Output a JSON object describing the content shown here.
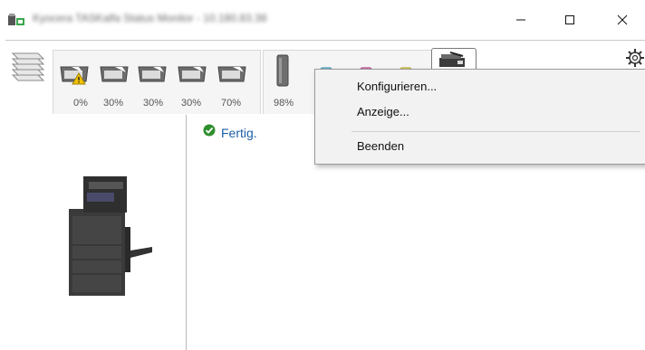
{
  "window": {
    "title": "Kyocera TASKalfa Status Monitor - 10.180.83.38",
    "buttons": {
      "minimize": "—",
      "maximize": "☐",
      "close": "✕"
    }
  },
  "toolbar": {
    "trays": [
      {
        "label": "0%",
        "warning": true
      },
      {
        "label": "30%",
        "warning": false
      },
      {
        "label": "30%",
        "warning": false
      },
      {
        "label": "30%",
        "warning": false
      },
      {
        "label": "70%",
        "warning": false
      }
    ],
    "toner": [
      {
        "label": "98%",
        "color": "#6f6f6f"
      },
      {
        "label": "",
        "color": "#2aa6d8"
      },
      {
        "label": "",
        "color": "#c8368c"
      },
      {
        "label": "",
        "color": "#e8d400"
      }
    ],
    "settings_icon": "gear-icon"
  },
  "status": {
    "text": "Fertig."
  },
  "context_menu": {
    "items": [
      "Konfigurieren...",
      "Anzeige...",
      "Beenden"
    ]
  }
}
